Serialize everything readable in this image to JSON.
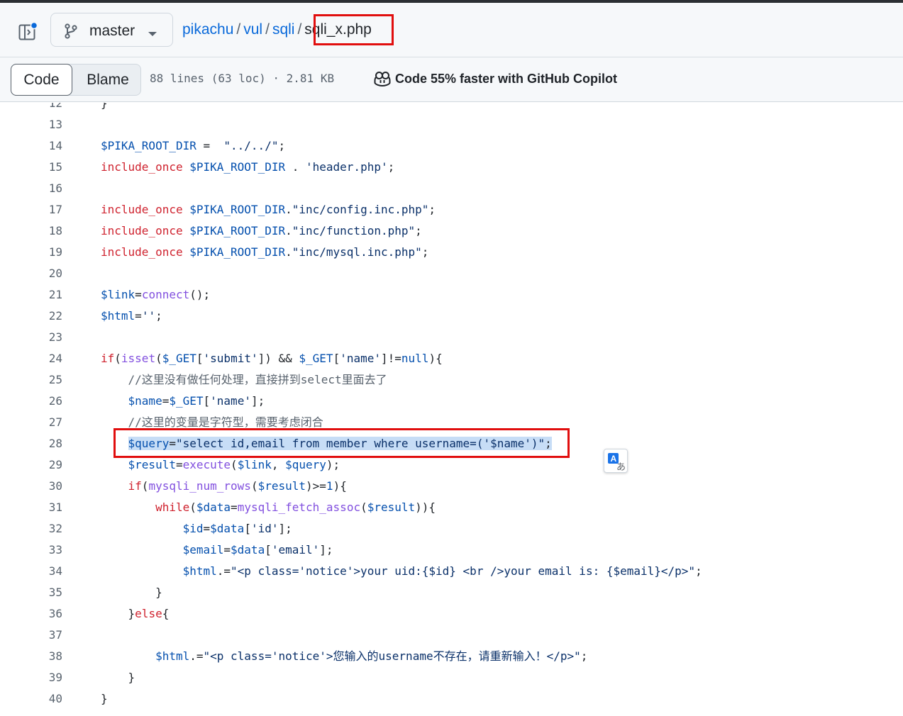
{
  "header": {
    "branch": "master",
    "breadcrumb": [
      {
        "label": "pikachu"
      },
      {
        "label": "vul"
      },
      {
        "label": "sqli"
      }
    ],
    "separator": "/",
    "file_name": "sqli_x.php"
  },
  "toolbar": {
    "code_tab": "Code",
    "blame_tab": "Blame",
    "file_meta": "88 lines (63 loc) · 2.81 KB",
    "copilot_text": "Code 55% faster with GitHub Copilot"
  },
  "code": {
    "line_numbers": [
      "12",
      "13",
      "14",
      "15",
      "16",
      "17",
      "18",
      "19",
      "20",
      "21",
      "22",
      "23",
      "24",
      "25",
      "26",
      "27",
      "28",
      "29",
      "30",
      "31",
      "32",
      "33",
      "34",
      "35",
      "36",
      "37",
      "38",
      "39",
      "40"
    ],
    "selected_line": "28"
  },
  "colors": {
    "link": "#0969da",
    "keyword": "#cf222e",
    "variable": "#0550ae",
    "string": "#0a3069",
    "function": "#8250df",
    "comment": "#59636e",
    "annotation_box": "#e10e0e",
    "selection": "#c7ddf6"
  },
  "icons": [
    "sidebar-toggle-icon",
    "git-branch-icon",
    "chevron-down-icon",
    "copilot-icon",
    "translate-icon"
  ]
}
